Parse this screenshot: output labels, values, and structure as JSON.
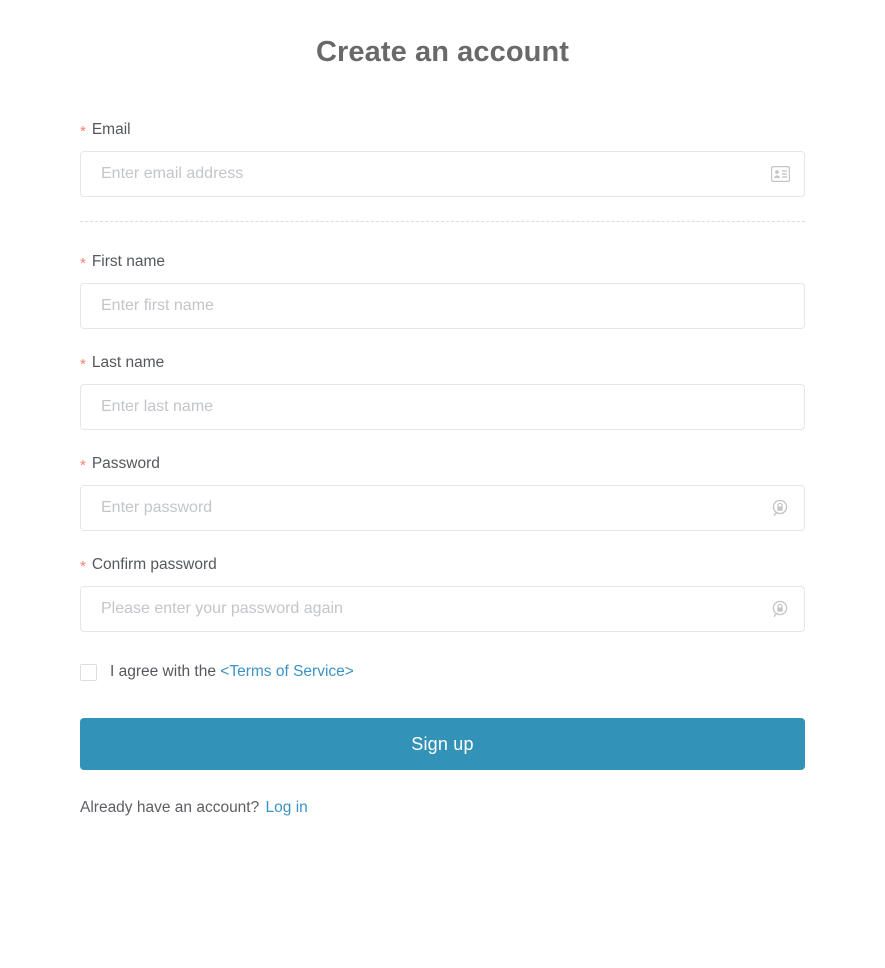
{
  "page": {
    "title": "Create an account"
  },
  "fields": {
    "email": {
      "label": "Email",
      "required_marker": "*",
      "placeholder": "Enter email address",
      "value": "",
      "icon": "contact-card-icon"
    },
    "first_name": {
      "label": "First name",
      "required_marker": "*",
      "placeholder": "Enter first name",
      "value": ""
    },
    "last_name": {
      "label": "Last name",
      "required_marker": "*",
      "placeholder": "Enter last name",
      "value": ""
    },
    "password": {
      "label": "Password",
      "required_marker": "*",
      "placeholder": "Enter password",
      "value": "",
      "icon": "lock-circle-icon"
    },
    "confirm_password": {
      "label": "Confirm password",
      "required_marker": "*",
      "placeholder": "Please enter your password again",
      "value": "",
      "icon": "lock-circle-icon"
    }
  },
  "terms": {
    "text": "I agree with the",
    "link_label": "<Terms of Service>",
    "checked": false
  },
  "actions": {
    "submit_label": "Sign up"
  },
  "footer": {
    "text": "Already have an account?",
    "link_label": "Log in"
  },
  "colors": {
    "accent": "#3392b8",
    "link": "#3c92c4",
    "required": "#f4816d",
    "border": "#e6e6ea",
    "placeholder": "#c2c5c9",
    "title": "#68696b"
  }
}
